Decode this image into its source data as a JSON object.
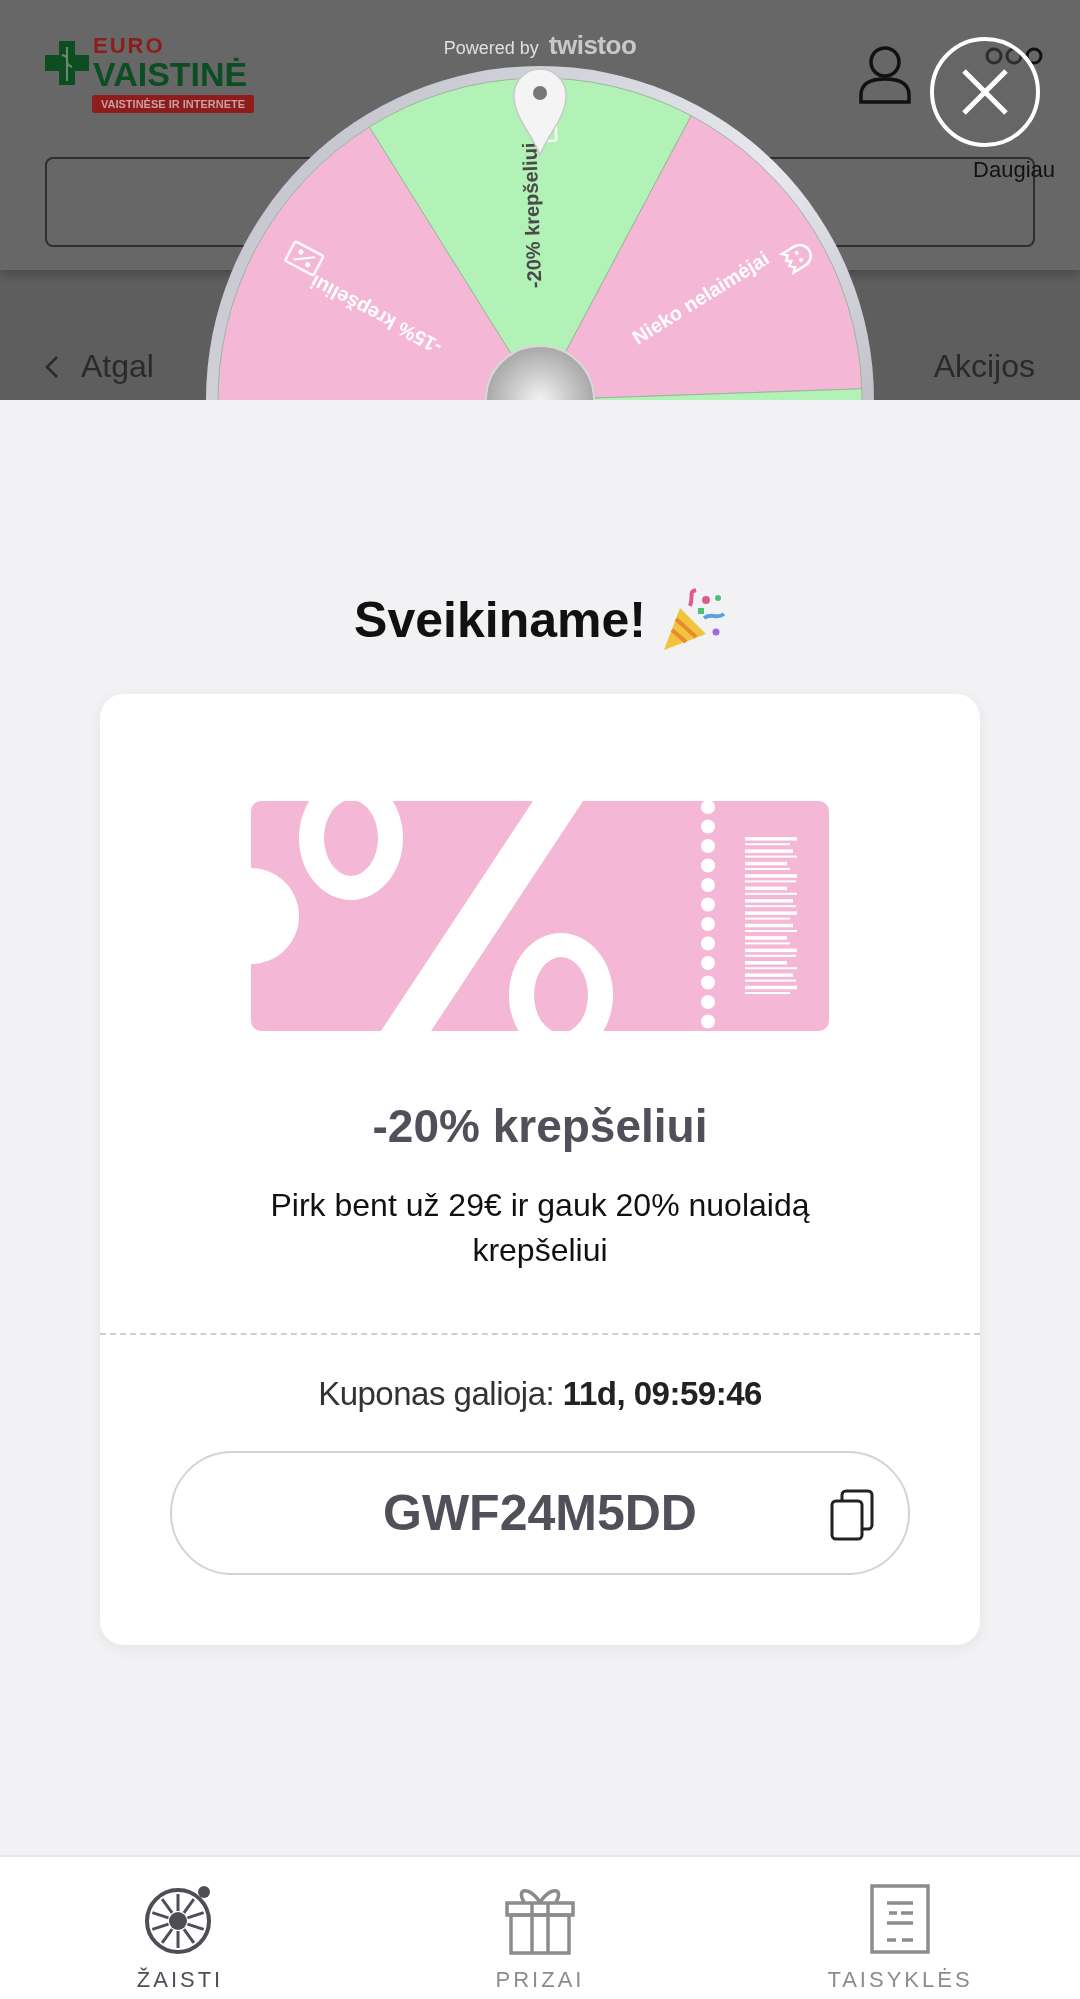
{
  "site": {
    "logo": {
      "top": "EURO",
      "main": "VAISTINĖ",
      "tagline": "VAISTINĖSE IR INTERNETE"
    },
    "menu_label": "Daugiau",
    "back_link": "Atgal",
    "section_link": "Akcijos"
  },
  "powered_by": {
    "label": "Powered by",
    "brand": "twistoo"
  },
  "wheel": {
    "segments": [
      {
        "label": "-15% krepšeliui",
        "kind": "coupon",
        "color": "#f4b8d6"
      },
      {
        "label": "-20% krepšeliui",
        "kind": "coupon",
        "color": "#b2f2b6"
      },
      {
        "label": "Nieko nelaimėjai",
        "kind": "nothing",
        "color": "#f4b8d6"
      },
      {
        "kind": "hidden",
        "color": "#b2f2b6"
      }
    ]
  },
  "result": {
    "title": "Sveikiname!",
    "prize_title": "-20% krepšeliui",
    "description": "Pirk bent už 29€ ir gauk 20% nuolaidą krepšeliui",
    "validity": "Kuponas galioja: **11d, 09:59:46**",
    "code": "GWF24M5DD"
  },
  "nav": [
    {
      "label": "ŽAISTI",
      "kind": "wheel",
      "selected": true
    },
    {
      "label": "PRIZAI",
      "kind": "gift",
      "selected": false
    },
    {
      "label": "TAISYKLĖS",
      "kind": "rules",
      "selected": false
    }
  ]
}
